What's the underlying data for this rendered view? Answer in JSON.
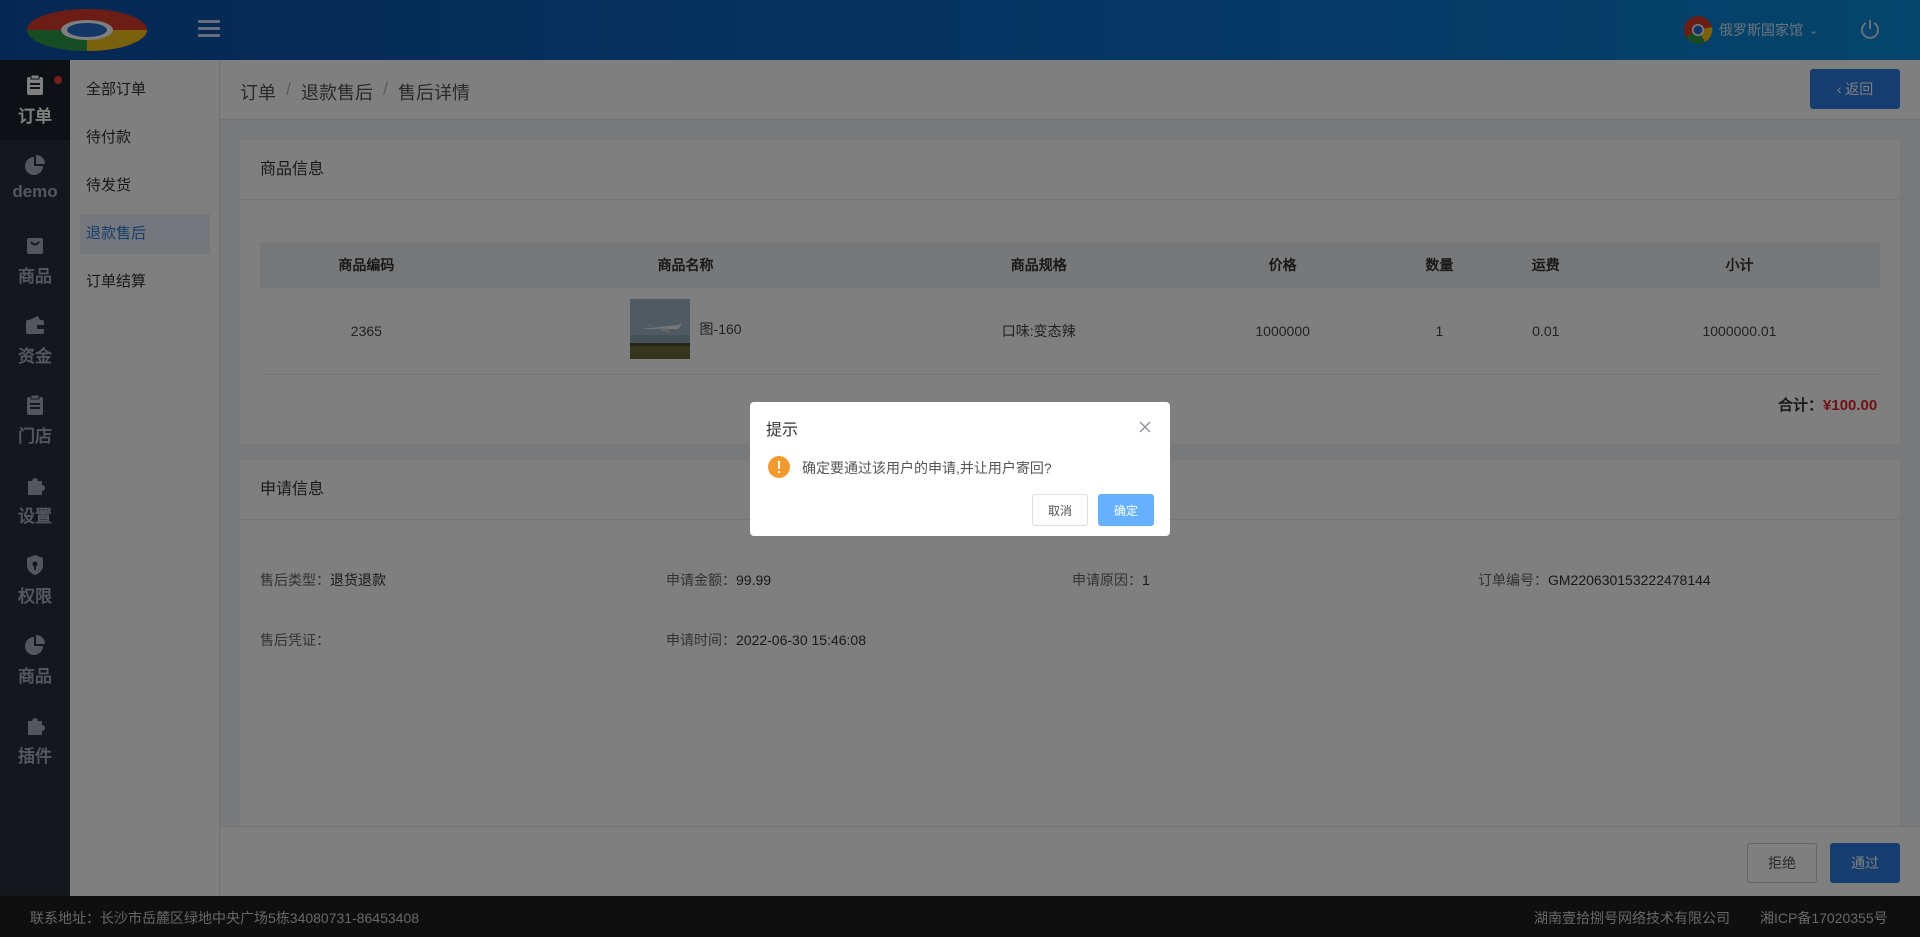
{
  "header": {
    "user_name": "俄罗斯国家馆",
    "colors": {
      "header_start": "#0a4fa8",
      "header_end": "#0a8ad8",
      "primary": "#2d7de0",
      "danger": "#e5222b"
    }
  },
  "sidebar": {
    "items": [
      {
        "label": "订单",
        "icon": "clipboard-icon"
      },
      {
        "label": "demo",
        "icon": "pie-chart-icon"
      },
      {
        "label": "商品",
        "icon": "bag-icon"
      },
      {
        "label": "资金",
        "icon": "wallet-icon"
      },
      {
        "label": "门店",
        "icon": "clipboard-icon"
      },
      {
        "label": "设置",
        "icon": "puzzle-icon"
      },
      {
        "label": "权限",
        "icon": "shield-icon"
      },
      {
        "label": "商品",
        "icon": "pie-chart-icon"
      },
      {
        "label": "插件",
        "icon": "puzzle-icon"
      }
    ]
  },
  "submenu": {
    "items": [
      "全部订单",
      "待付款",
      "待发货",
      "退款售后",
      "订单结算"
    ]
  },
  "breadcrumb": {
    "items": [
      "订单",
      "退款售后",
      "售后详情"
    ],
    "separator": "/"
  },
  "back_button": "返回",
  "goods_panel": {
    "title": "商品信息",
    "columns": [
      "商品编码",
      "商品名称",
      "商品规格",
      "价格",
      "数量",
      "运费",
      "小计"
    ],
    "row": {
      "code": "2365",
      "name": "图-160",
      "spec": "口味:变态辣",
      "price": "1000000",
      "qty": "1",
      "freight": "0.01",
      "subtotal": "1000000.01"
    },
    "total_label": "合计：",
    "total_value": "¥100.00"
  },
  "apply_panel": {
    "title": "申请信息",
    "type_label": "售后类型：",
    "type_value": "退货退款",
    "amount_label": "申请金额：",
    "amount_value": "99.99",
    "reason_label": "申请原因：",
    "reason_value": "1",
    "order_label": "订单编号：",
    "order_value": "GM220630153222478144",
    "proof_label": "售后凭证：",
    "time_label": "申请时间：",
    "time_value": "2022-06-30 15:46:08"
  },
  "actions": {
    "reject": "拒绝",
    "pass": "通过"
  },
  "footer": {
    "address": "联系地址：长沙市岳麓区绿地中央广场5栋34080731-86453408",
    "company": "湖南壹拾捌号网络技术有限公司",
    "icp": "湘ICP备17020355号"
  },
  "dialog": {
    "title": "提示",
    "message": "确定要通过该用户的申请,并让用户寄回?",
    "cancel": "取消",
    "confirm": "确定"
  }
}
